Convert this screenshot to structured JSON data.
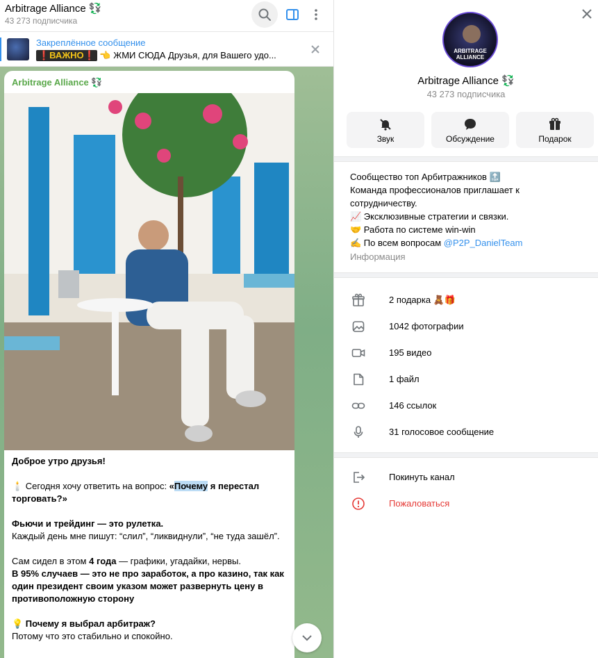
{
  "chat": {
    "title": "Arbitrage Alliance 💱",
    "subscribers": "43 273 подписчика",
    "pinned": {
      "title": "Закреплённое сообщение",
      "badge": "❗ВАЖНО❗",
      "text": "👈 ЖМИ СЮДА  Друзья, для Вашего удо..."
    },
    "message": {
      "author": "Arbitrage Alliance 💱",
      "greeting": "Доброе утро друзья!",
      "q_prefix": "🕯️ Сегодня хочу ответить на вопрос: ",
      "q_quote_open": "«",
      "q_highlight": "Почему",
      "q_rest": " я перестал торговать?»",
      "p2_bold": "Фьючи  и трейдинг — это рулетка.",
      "p2_text": "Каждый день мне пишут: “слил”, “ликвиднули”, “не туда зашёл”.",
      "p3_a": "Сам сидел в этом ",
      "p3_bold": "4 года",
      "p3_b": " — графики, угадайки, нервы.",
      "p3_bold2": "В 95% случаев — это не про заработок, а про казино, так как один президент своим указом может развернуть цену в противоположную сторону",
      "p4_bold": "💡 Почему я выбрал арбитраж?",
      "p4_text": "Потому что это стабильно и спокойно."
    }
  },
  "info": {
    "avatar_text": "ARBITRAGE ALLIANCE",
    "name": "Arbitrage Alliance 💱",
    "subscribers": "43 273 подписчика",
    "buttons": [
      {
        "label": "Звук",
        "icon": "bell-off-icon"
      },
      {
        "label": "Обсуждение",
        "icon": "chat-bubble-icon"
      },
      {
        "label": "Подарок",
        "icon": "gift-icon"
      }
    ],
    "about_lines": [
      "Сообщество топ Арбитражников 🔝",
      "Команда профессионалов приглашает к сотрудничеству.",
      "📈 Эксклюзивные стратегии и связки.",
      "🤝 Работа по системе win-win"
    ],
    "about_contact_prefix": "✍️ По всем вопросам ",
    "about_contact_link": "@P2P_DanielTeam",
    "about_label": "Информация",
    "media_rows": [
      {
        "label": "2 подарка 🧸🎁",
        "icon": "gift-icon"
      },
      {
        "label": "1042 фотографии",
        "icon": "photo-icon"
      },
      {
        "label": "195 видео",
        "icon": "video-icon"
      },
      {
        "label": "1 файл",
        "icon": "file-icon"
      },
      {
        "label": "146 ссылок",
        "icon": "link-icon"
      },
      {
        "label": "31 голосовое сообщение",
        "icon": "microphone-icon"
      }
    ],
    "leave": "Покинуть канал",
    "report": "Пожаловаться"
  },
  "colors": {
    "accent": "#3390ec",
    "author": "#5aa84a",
    "danger": "#e53935"
  }
}
